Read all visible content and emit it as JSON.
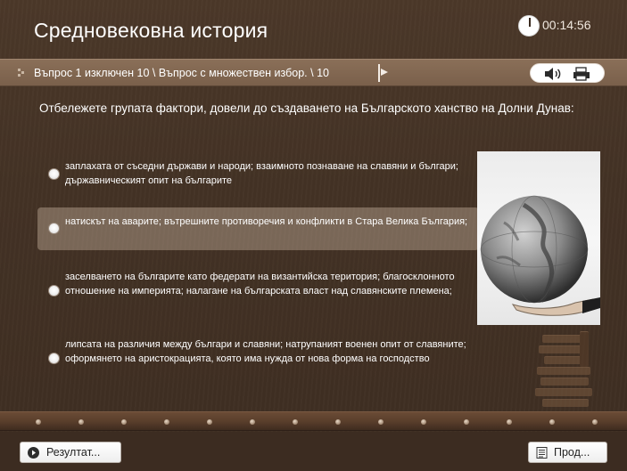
{
  "header": {
    "title": "Средновековна история",
    "timer": "00:14:56"
  },
  "progress": {
    "text": "Въпрос 1 изключен 10 \\ Въпрос с множествен избор. \\ 10"
  },
  "toolbar": {
    "sound_icon": "speaker-icon",
    "print_icon": "printer-icon"
  },
  "question": {
    "text": "Отбележете групата фактори, довели до създаването на Българското ханство на Долни Дунав:"
  },
  "answers": [
    {
      "text": "заплахата от съседни държави и народи; взаимното познаване на славяни и българи; държавническият опит на българите"
    },
    {
      "text": "натискът на аварите; вътрешните противоречия и конфликти в Стара Велика България;"
    },
    {
      "text": "заселването на българите като федерати на византийска територия; благосклонното отношение на империята; налагане на българската власт над славянските племена;"
    },
    {
      "text": "липсата на различия между българи и славяни; натрупаният военен опит от славяните; оформянето на аристокрацията, която има нужда от нова форма на господство"
    }
  ],
  "footer": {
    "result_label": "Резултат...",
    "next_label": "Прод..."
  },
  "colors": {
    "background": "#433225",
    "strip": "#7a604b",
    "text": "#ffffff"
  }
}
